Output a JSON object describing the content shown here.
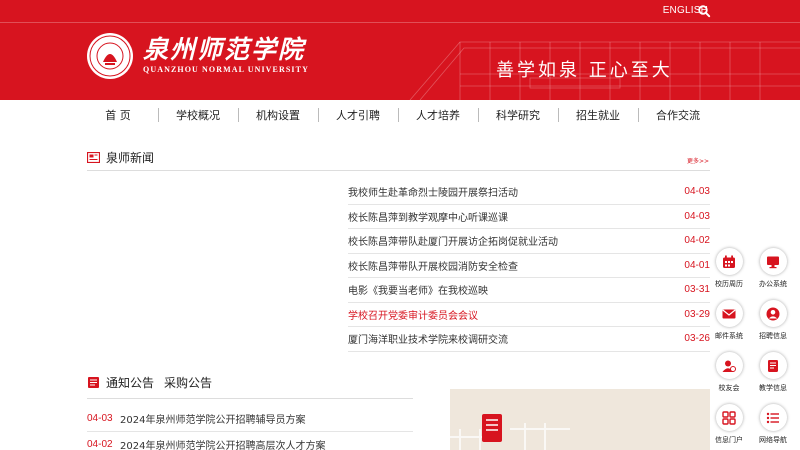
{
  "header": {
    "english_link": "ENGLISH",
    "logo_cn": "泉州师范学院",
    "logo_en": "QUANZHOU NORMAL UNIVERSITY",
    "motto": "善学如泉 正心至大",
    "brand_color": "#d7141f"
  },
  "nav": [
    "首 页",
    "学校概况",
    "机构设置",
    "人才引聘",
    "人才培养",
    "科学研究",
    "招生就业",
    "合作交流"
  ],
  "news": {
    "title": "泉师新闻",
    "more": "更多>>",
    "items": [
      {
        "title": "我校师生赴革命烈士陵园开展祭扫活动",
        "date": "04-03"
      },
      {
        "title": "校长陈昌萍到教学观摩中心听课巡课",
        "date": "04-03"
      },
      {
        "title": "校长陈昌萍带队赴厦门开展访企拓岗促就业活动",
        "date": "04-02"
      },
      {
        "title": "校长陈昌萍带队开展校园消防安全检查",
        "date": "04-01"
      },
      {
        "title": "电影《我要当老师》在我校巡映",
        "date": "03-31"
      },
      {
        "title": "学校召开党委审计委员会会议",
        "date": "03-29"
      },
      {
        "title": "厦门海洋职业技术学院来校调研交流",
        "date": "03-26"
      }
    ]
  },
  "notice": {
    "title": "通知公告",
    "title2": "采购公告",
    "items": [
      {
        "date": "04-03",
        "title": "2024年泉州师范学院公开招聘辅导员方案"
      },
      {
        "date": "04-02",
        "title": "2024年泉州师范学院公开招聘高层次人才方案"
      }
    ]
  },
  "quick_links": [
    {
      "label": "校历周历",
      "icon": "calendar-icon"
    },
    {
      "label": "办公系统",
      "icon": "monitor-icon"
    },
    {
      "label": "邮件系统",
      "icon": "mail-icon"
    },
    {
      "label": "招聘信息",
      "icon": "user-icon"
    },
    {
      "label": "校友会",
      "icon": "alumni-icon"
    },
    {
      "label": "教学信息",
      "icon": "document-icon"
    },
    {
      "label": "信息门户",
      "icon": "grid-icon"
    },
    {
      "label": "网络导航",
      "icon": "list-icon"
    }
  ]
}
